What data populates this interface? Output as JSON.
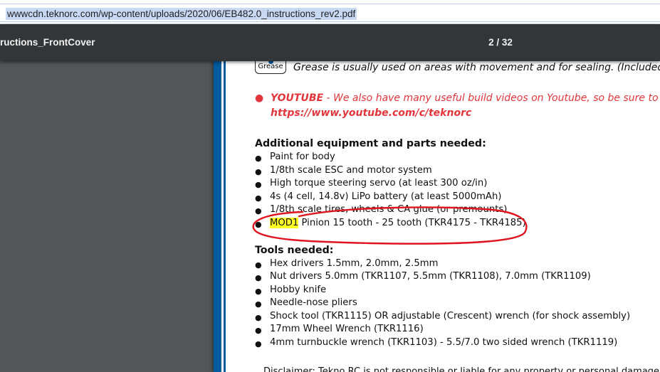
{
  "browser": {
    "url": "wwwcdn.teknorc.com/wp-content/uploads/2020/06/EB482.0_instructions_rev2.pdf"
  },
  "pdf_toolbar": {
    "title": "ructions_FrontCover",
    "page_indicator": "2 / 32"
  },
  "page": {
    "grease_icon_label": "Grease",
    "grease_text": "Grease is usually used on areas with movement and for sealing. (Included with",
    "youtube": {
      "bullet": "●",
      "label": "YOUTUBE",
      "text": " - We also have many useful build videos on Youtube, so be sure to chec",
      "link": "https://www.youtube.com/c/teknorc"
    },
    "additional": {
      "heading": "Additional equipment and parts needed:",
      "items": [
        "Paint for body",
        "1/8th scale ESC and motor system",
        "High torque steering servo (at least 300 oz/in)",
        "4s (4 cell, 14.8v) LiPo battery (at least 5000mAh)",
        "1/8th scale tires, wheels & CA glue (or premounts)"
      ],
      "highlight_item_mark": "MOD1",
      "highlight_item_rest": " Pinion 15 tooth - 25 tooth (TKR4175 - TKR4185)"
    },
    "tools": {
      "heading": "Tools needed:",
      "items": [
        "Hex drivers 1.5mm, 2.0mm, 2.5mm",
        "Nut drivers 5.0mm (TKR1107, 5.5mm (TKR1108), 7.0mm (TKR1109)",
        "Hobby knife",
        "Needle-nose pliers",
        "Shock tool (TKR1115) OR adjustable (Crescent) wrench (for shock assembly)",
        "17mm Wheel Wrench (TKR1116)",
        "4mm turnbuckle wrench (TKR1103) - 5.5/7.0 two sided wrench (TKR1119)"
      ]
    },
    "bullet_char": "●",
    "disclaimer": "Disclaimer: Tekno RC is not responsible or liable for any property or personal damage, loss, or"
  },
  "colors": {
    "toolbar": "#323639",
    "viewer_bg": "#525659",
    "page_edge": "#005b9f",
    "youtube_red": "#e2363c",
    "highlight": "#ffff22",
    "annotation_red": "#e0141e"
  }
}
